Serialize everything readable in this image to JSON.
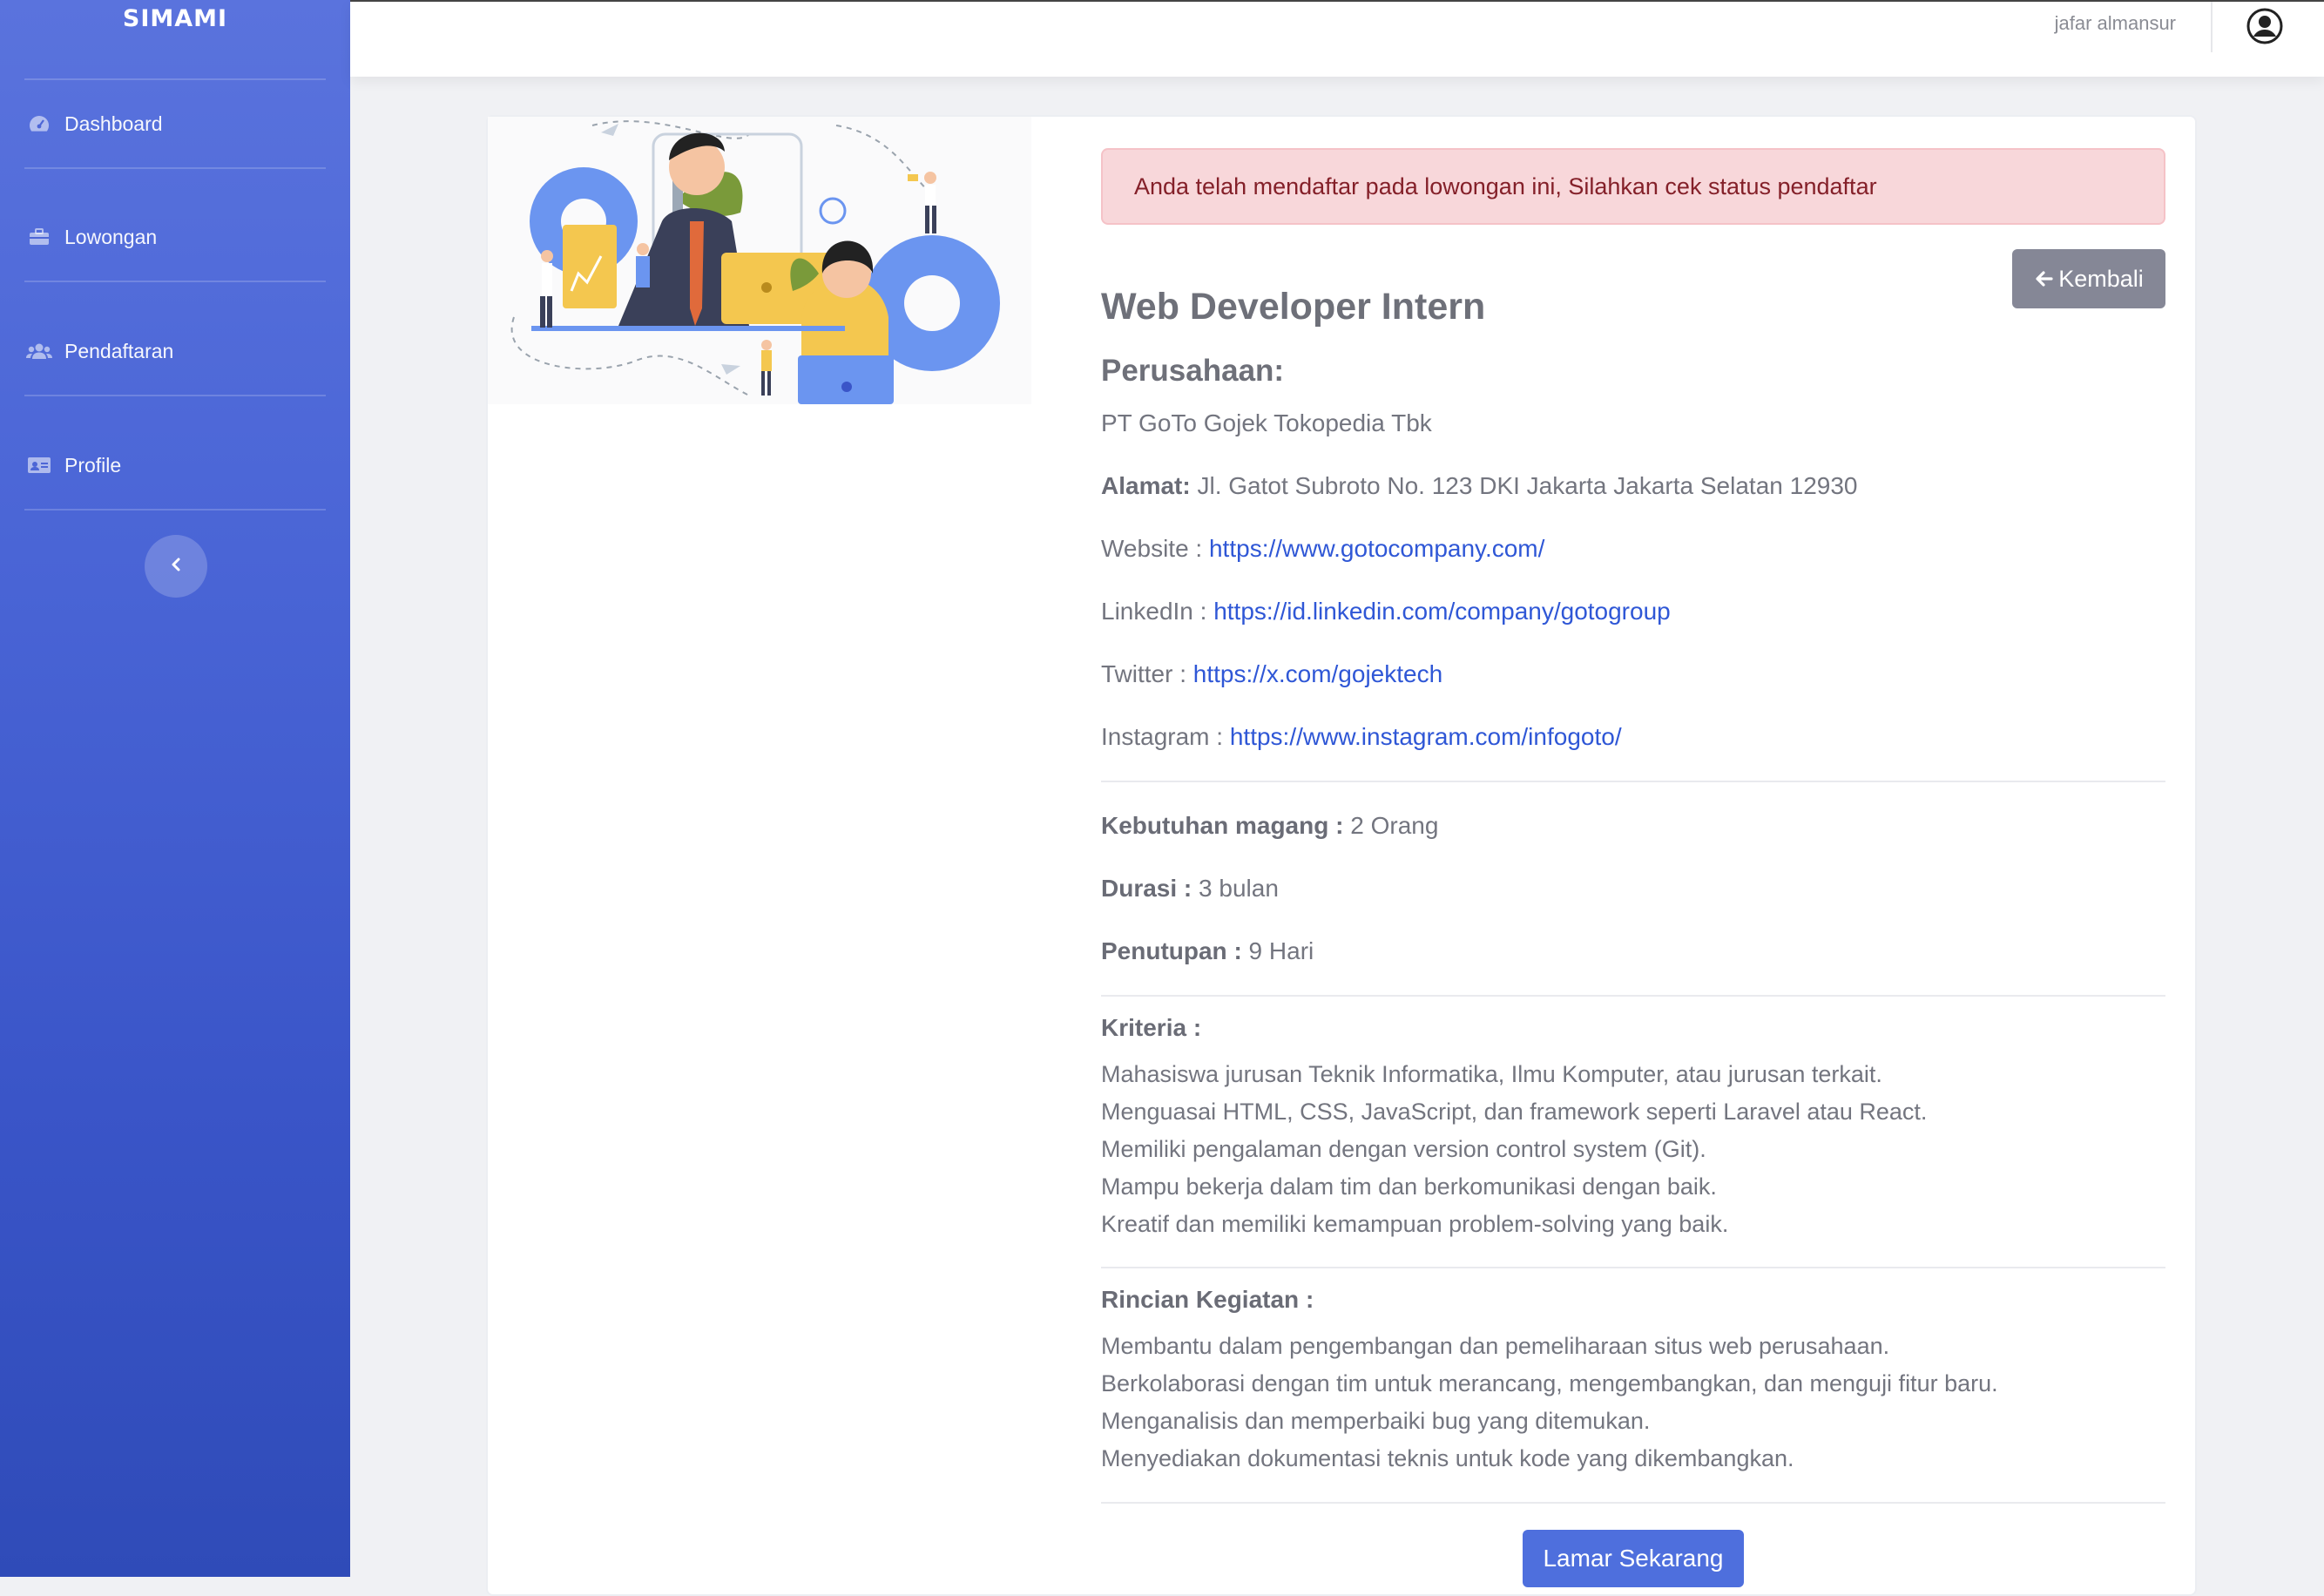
{
  "sidebar": {
    "brand": "SIMAMI",
    "items": [
      {
        "label": "Dashboard",
        "icon": "tachometer-icon"
      },
      {
        "label": "Lowongan",
        "icon": "briefcase-icon"
      },
      {
        "label": "Pendaftaran",
        "icon": "users-icon"
      },
      {
        "label": "Profile",
        "icon": "id-card-icon"
      }
    ],
    "toggle_icon": "chevron-left-icon"
  },
  "topbar": {
    "user_name": "jafar almansur",
    "user_icon": "user-circle-icon"
  },
  "alert": {
    "text": "Anda telah mendaftar pada lowongan ini, Silahkan cek status pendaftar"
  },
  "back_button": {
    "label": "Kembali",
    "icon": "arrow-left-icon"
  },
  "job": {
    "title": "Web Developer Intern",
    "company_heading": "Perusahaan:",
    "company_name": "PT GoTo Gojek Tokopedia Tbk",
    "address_label": "Alamat:",
    "address": "Jl. Gatot Subroto No. 123 DKI Jakarta Jakarta Selatan 12930",
    "website_label": "Website :",
    "website": "https://www.gotocompany.com/",
    "linkedin_label": "LinkedIn :",
    "linkedin": "https://id.linkedin.com/company/gotogroup",
    "twitter_label": "Twitter :",
    "twitter": "https://x.com/gojektech",
    "instagram_label": "Instagram :",
    "instagram": "https://www.instagram.com/infogoto/",
    "need_label": "Kebutuhan magang :",
    "need": "2 Orang",
    "duration_label": "Durasi :",
    "duration": "3 bulan",
    "closing_label": "Penutupan :",
    "closing": "9 Hari",
    "criteria_label": "Kriteria :",
    "criteria": [
      "Mahasiswa jurusan Teknik Informatika, Ilmu Komputer, atau jurusan terkait.",
      "Menguasai HTML, CSS, JavaScript, dan framework seperti Laravel atau React.",
      "Memiliki pengalaman dengan version control system (Git).",
      "Mampu bekerja dalam tim dan berkomunikasi dengan baik.",
      "Kreatif dan memiliki kemampuan problem-solving yang baik."
    ],
    "activities_label": "Rincian Kegiatan :",
    "activities": [
      "Membantu dalam pengembangan dan pemeliharaan situs web perusahaan.",
      "Berkolaborasi dengan tim untuk merancang, mengembangkan, dan menguji fitur baru.",
      "Menganalisis dan memperbaiki bug yang ditemukan.",
      "Menyediakan dokumentasi teknis untuk kode yang dikembangkan."
    ]
  },
  "apply_button": {
    "label": "Lamar Sekarang"
  }
}
